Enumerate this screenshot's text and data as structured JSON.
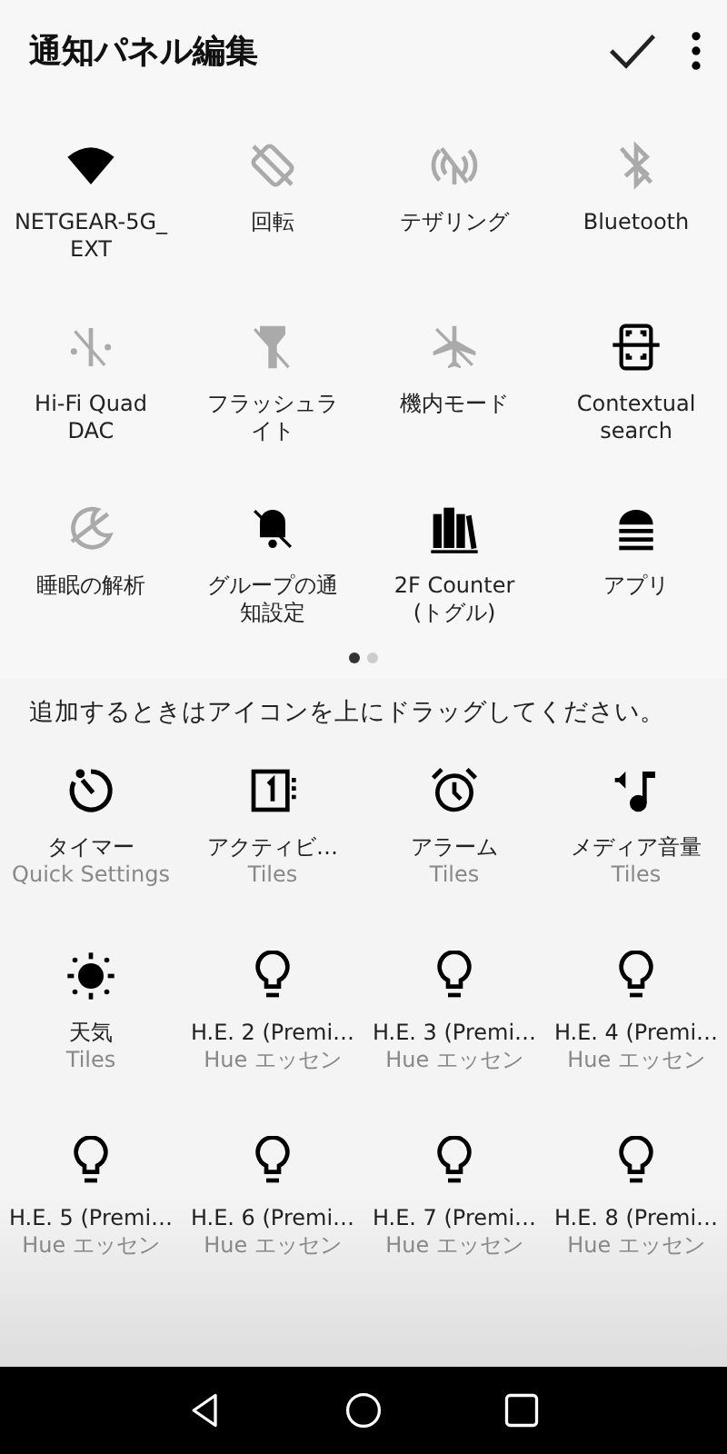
{
  "header": {
    "title": "通知パネル編集"
  },
  "active_tiles": [
    {
      "kind": "wifi",
      "label": "NETGEAR-5G_\nEXT",
      "on": true
    },
    {
      "kind": "rotation",
      "label": "回転",
      "on": false
    },
    {
      "kind": "tethering",
      "label": "テザリング",
      "on": false
    },
    {
      "kind": "bluetooth",
      "label": "Bluetooth",
      "on": false
    },
    {
      "kind": "dac",
      "label": "Hi-Fi Quad\nDAC",
      "on": false
    },
    {
      "kind": "flashlight",
      "label": "フラッシュライト",
      "on": false
    },
    {
      "kind": "airplane",
      "label": "機内モード",
      "on": false
    },
    {
      "kind": "scan",
      "label": "Contextual\nsearch",
      "on": true
    },
    {
      "kind": "sleep",
      "label": "睡眠の解析",
      "on": false
    },
    {
      "kind": "bell-off",
      "label": "グループの通知設定",
      "on": true
    },
    {
      "kind": "books",
      "label": "2F Counter (トグル)",
      "on": true
    },
    {
      "kind": "android",
      "label": "アプリ",
      "on": true
    }
  ],
  "pages": [
    {
      "selected": true
    },
    {
      "selected": false
    }
  ],
  "hint": "追加するときはアイコンを上にドラッグしてください。",
  "available_tiles": [
    {
      "kind": "timer",
      "label": "タイマー",
      "source": "Quick Settings"
    },
    {
      "kind": "calendar",
      "label": "アクティビ…",
      "source": "Tiles"
    },
    {
      "kind": "alarm",
      "label": "アラーム",
      "source": "Tiles"
    },
    {
      "kind": "media",
      "label": "メディア音量",
      "source": "Tiles"
    },
    {
      "kind": "sun",
      "label": "天気",
      "source": "Tiles"
    },
    {
      "kind": "bulb",
      "label": "H.E. 2 (Premi…",
      "source": "Hue エッセン"
    },
    {
      "kind": "bulb",
      "label": "H.E. 3 (Premi…",
      "source": "Hue エッセン"
    },
    {
      "kind": "bulb",
      "label": "H.E. 4 (Premi…",
      "source": "Hue エッセン"
    },
    {
      "kind": "bulb",
      "label": "H.E. 5 (Premi…",
      "source": "Hue エッセン"
    },
    {
      "kind": "bulb",
      "label": "H.E. 6 (Premi…",
      "source": "Hue エッセン"
    },
    {
      "kind": "bulb",
      "label": "H.E. 7 (Premi…",
      "source": "Hue エッセン"
    },
    {
      "kind": "bulb",
      "label": "H.E. 8 (Premi…",
      "source": "Hue エッセン"
    }
  ]
}
